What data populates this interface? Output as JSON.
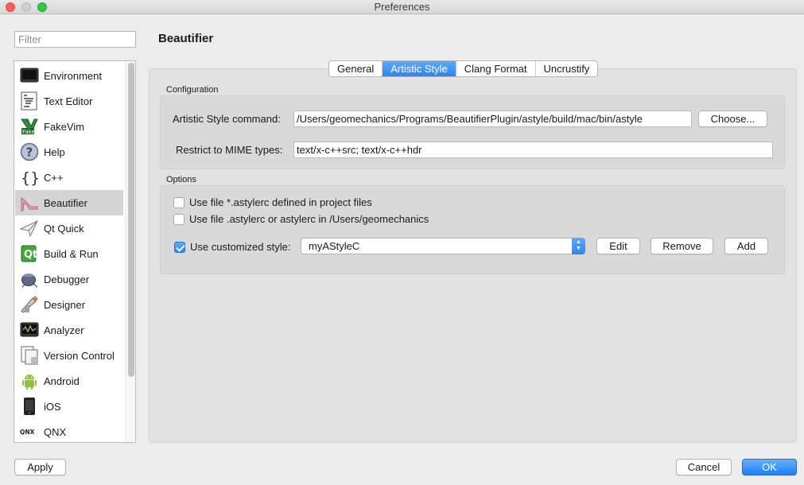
{
  "window": {
    "title": "Preferences"
  },
  "filter": {
    "placeholder": "Filter"
  },
  "sidebar": {
    "items": [
      {
        "label": "Environment",
        "icon": "monitor-icon"
      },
      {
        "label": "Text Editor",
        "icon": "text-document-icon"
      },
      {
        "label": "FakeVim",
        "icon": "fakevim-icon"
      },
      {
        "label": "Help",
        "icon": "help-icon"
      },
      {
        "label": "C++",
        "icon": "braces-icon"
      },
      {
        "label": "Beautifier",
        "icon": "high-heel-icon",
        "selected": true
      },
      {
        "label": "Qt Quick",
        "icon": "paper-plane-icon"
      },
      {
        "label": "Build & Run",
        "icon": "build-run-icon"
      },
      {
        "label": "Debugger",
        "icon": "bug-icon"
      },
      {
        "label": "Designer",
        "icon": "pencil-ruler-icon"
      },
      {
        "label": "Analyzer",
        "icon": "oscilloscope-icon"
      },
      {
        "label": "Version Control",
        "icon": "version-control-icon"
      },
      {
        "label": "Android",
        "icon": "android-icon"
      },
      {
        "label": "iOS",
        "icon": "phone-icon"
      },
      {
        "label": "QNX",
        "icon": "qnx-logo-icon"
      }
    ]
  },
  "page": {
    "title": "Beautifier"
  },
  "tabs": [
    {
      "label": "General",
      "active": false
    },
    {
      "label": "Artistic Style",
      "active": true
    },
    {
      "label": "Clang Format",
      "active": false
    },
    {
      "label": "Uncrustify",
      "active": false
    }
  ],
  "configuration": {
    "group_label": "Configuration",
    "command_label": "Artistic Style command:",
    "command_value": "/Users/geomechanics/Programs/BeautifierPlugin/astyle/build/mac/bin/astyle",
    "choose_label": "Choose...",
    "mime_label": "Restrict to MIME types:",
    "mime_value": "text/x-c++src; text/x-c++hdr"
  },
  "options": {
    "group_label": "Options",
    "project_files_label": "Use file *.astylerc defined in project files",
    "project_files_checked": false,
    "home_file_label": "Use file .astylerc or astylerc in /Users/geomechanics",
    "home_file_checked": false,
    "customized_label": "Use customized style:",
    "customized_checked": true,
    "style_value": "myAStyleC",
    "edit_label": "Edit",
    "remove_label": "Remove",
    "add_label": "Add"
  },
  "footer": {
    "apply_label": "Apply",
    "cancel_label": "Cancel",
    "ok_label": "OK"
  },
  "colors": {
    "accent": "#2c86ee",
    "selection": "#d4d4d4"
  }
}
